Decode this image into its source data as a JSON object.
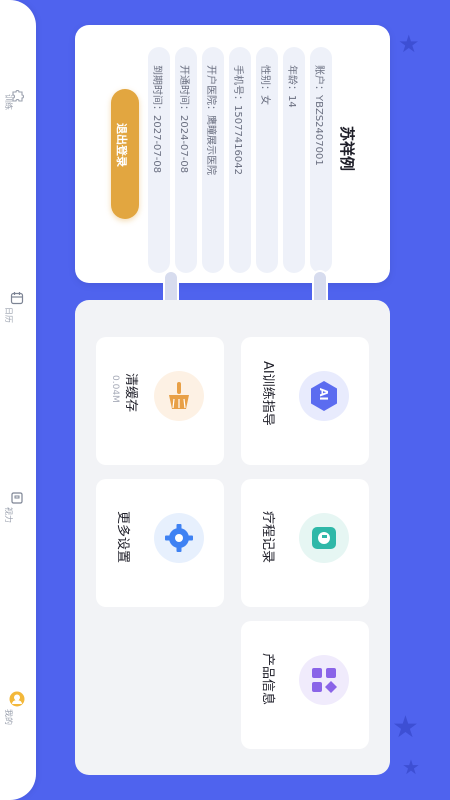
{
  "sidebar": {
    "items": [
      {
        "label": "训练",
        "icon": "puzzle-icon"
      },
      {
        "label": "日历",
        "icon": "calendar-icon"
      },
      {
        "label": "视力",
        "icon": "eye-chart-icon"
      },
      {
        "label": "我的",
        "icon": "avatar-icon"
      }
    ]
  },
  "profile": {
    "name": "苏祥例",
    "account": "账户：YBZS2407001",
    "age": "年龄：14",
    "gender": "性别：女",
    "phone": "手机号：15077416042",
    "hospital": "开户医院：鹰瞳展示医院",
    "open_date": "开通时间：2024-07-08",
    "expire_date": "到期时间：2027-07-08",
    "logout_label": "退出登录"
  },
  "menu": {
    "ai_guide": "AI训练指导",
    "course_record": "疗程记录",
    "product_info": "产品信息",
    "clear_cache": "清缓存",
    "cache_size": "0.04M",
    "more_settings": "更多设置",
    "ai_badge": "AI"
  },
  "colors": {
    "background": "#4f63ee",
    "logout": "#e2a640",
    "ai_icon": "#5b6cf0",
    "record_icon": "#2fb8a8",
    "product_icon": "#8a64e8",
    "settings_icon": "#3f82f3",
    "cache_icon": "#e8a047"
  }
}
